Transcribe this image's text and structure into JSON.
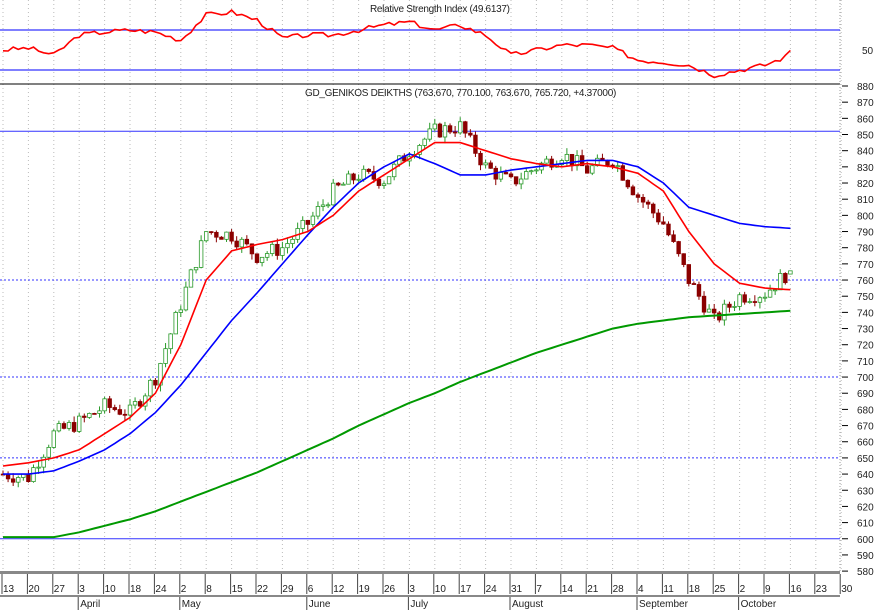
{
  "chart_data": {
    "type": "candlestick",
    "rsi": {
      "title": "Relative Strength Index (49.6137)",
      "levels": [
        70,
        30
      ],
      "tick_labels": [
        "50"
      ],
      "weekly_values": [
        50,
        52,
        45,
        65,
        68,
        70,
        68,
        60,
        85,
        88,
        80,
        62,
        65,
        65,
        70,
        75,
        78,
        70,
        75,
        65,
        45,
        50,
        55,
        55,
        52,
        40,
        38,
        35,
        25,
        30,
        35,
        45,
        49.6
      ]
    },
    "price": {
      "title": "GD_GENIKOS DEIKTHS (763.670, 770.100, 763.670, 765.720, +4.37000)",
      "ylim": [
        580,
        880
      ],
      "y_ticks": [
        "880",
        "870",
        "860",
        "850",
        "840",
        "830",
        "820",
        "810",
        "800",
        "790",
        "780",
        "770",
        "760",
        "750",
        "740",
        "730",
        "720",
        "710",
        "700",
        "690",
        "680",
        "670",
        "660",
        "650",
        "640",
        "630",
        "620",
        "610",
        "600",
        "590",
        "580"
      ],
      "weekly_close": [
        640,
        638,
        665,
        672,
        682,
        678,
        700,
        745,
        790,
        788,
        775,
        780,
        795,
        815,
        825,
        822,
        840,
        852,
        855,
        830,
        820,
        830,
        838,
        828,
        835,
        812,
        795,
        760,
        735,
        750,
        752,
        766
      ],
      "ma_short": [
        645,
        647,
        650,
        655,
        665,
        675,
        690,
        720,
        760,
        778,
        782,
        785,
        790,
        800,
        815,
        825,
        835,
        845,
        845,
        840,
        835,
        832,
        830,
        832,
        830,
        826,
        815,
        790,
        770,
        758,
        755,
        754
      ],
      "ma_mid": [
        640,
        640,
        642,
        648,
        655,
        665,
        678,
        695,
        715,
        735,
        752,
        770,
        788,
        805,
        820,
        830,
        838,
        832,
        825,
        825,
        828,
        830,
        832,
        834,
        834,
        830,
        820,
        805,
        800,
        795,
        793,
        792
      ],
      "ma_long": [
        601,
        601,
        601,
        604,
        608,
        612,
        617,
        623,
        629,
        635,
        641,
        648,
        655,
        662,
        670,
        677,
        684,
        690,
        697,
        703,
        709,
        715,
        720,
        725,
        730,
        733,
        735,
        737,
        738,
        739,
        740,
        741
      ],
      "ref_lines": [
        852,
        760,
        700,
        650,
        600
      ]
    },
    "x_ticks": [
      "13",
      "20",
      "27",
      "3",
      "10",
      "18",
      "24",
      "2",
      "8",
      "15",
      "22",
      "29",
      "6",
      "12",
      "19",
      "26",
      "3",
      "10",
      "17",
      "24",
      "31",
      "7",
      "14",
      "21",
      "28",
      "4",
      "11",
      "18",
      "25",
      "2",
      "9",
      "16",
      "23",
      "30"
    ],
    "months": [
      {
        "label": "April",
        "week": 3
      },
      {
        "label": "May",
        "week": 7
      },
      {
        "label": "June",
        "week": 12
      },
      {
        "label": "July",
        "week": 16
      },
      {
        "label": "August",
        "week": 20
      },
      {
        "label": "September",
        "week": 25
      },
      {
        "label": "October",
        "week": 29
      }
    ],
    "colors": {
      "up": "#2a9a2a",
      "down": "#8b0000",
      "rsi": "#ff0000",
      "ma_short": "#ff0000",
      "ma_mid": "#0000ff",
      "ma_long": "#009900",
      "level": "#3333ff"
    }
  }
}
